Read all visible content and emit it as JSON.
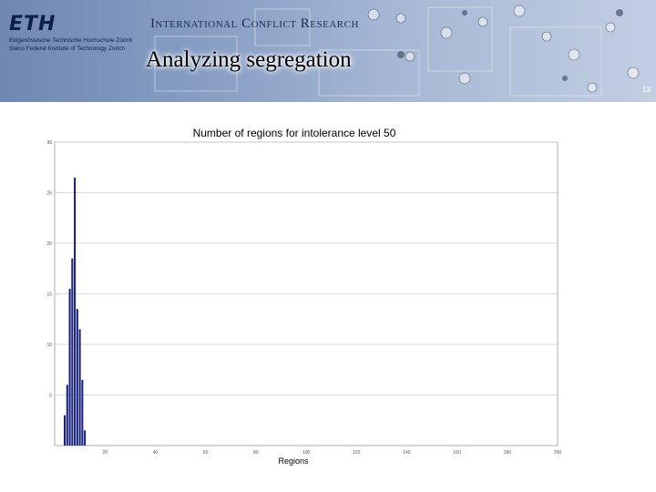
{
  "header": {
    "logo": "ETH",
    "institution_de": "Eidgenössische Technische Hochschule Zürich",
    "institution_en": "Swiss Federal Institute of Technology Zurich",
    "unit": "International Conflict Research",
    "slide_title": "Analyzing segregation",
    "slide_number": "13"
  },
  "colors": {
    "bar": "#1a237e",
    "grid": "#cccccc",
    "header_dark": "#0d1f4a"
  },
  "chart_data": {
    "type": "bar",
    "title": "Number of regions for intolerance level 50",
    "xlabel": "Regions",
    "ylabel": "",
    "xlim": [
      0,
      200
    ],
    "ylim": [
      0,
      30
    ],
    "x_ticks": [
      "20",
      "40",
      "60",
      "80",
      "100",
      "120",
      "140",
      "160",
      "180",
      "200"
    ],
    "y_ticks": [
      "5",
      "10",
      "15",
      "20",
      "25",
      "30"
    ],
    "grid": true,
    "x": [
      4,
      5,
      6,
      7,
      8,
      9,
      10,
      11,
      12,
      13
    ],
    "values": [
      3,
      6,
      15.5,
      18.5,
      26.5,
      13.5,
      11.5,
      6.5,
      1.5,
      0
    ]
  }
}
